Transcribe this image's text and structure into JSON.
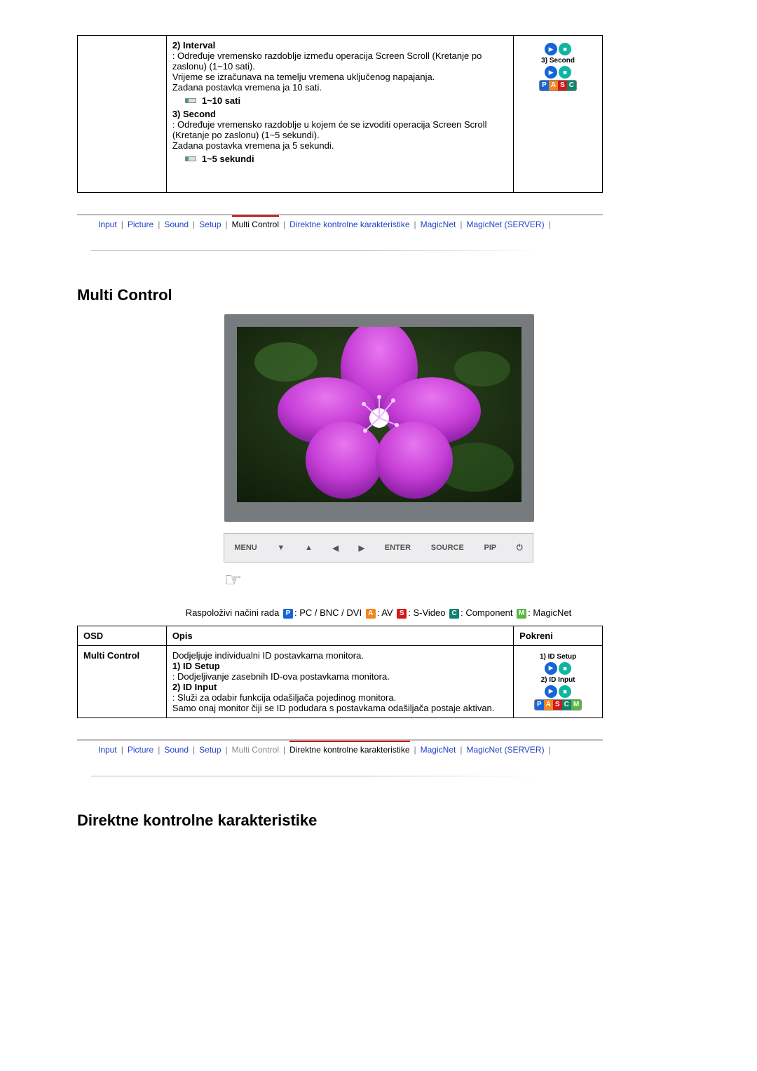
{
  "top_section": {
    "interval_heading": "2) Interval",
    "interval_text1": ": Određuje vremensko razdoblje između operacija Screen Scroll (Kretanje po zaslonu) (1~10 sati).",
    "interval_text2": "Vrijeme se izračunava na temelju vremena uključenog napajanja.",
    "interval_text3": "Zadana postavka vremena ja 10 sati.",
    "interval_bullet": "1~10 sati",
    "second_heading": "3) Second",
    "second_text1": ": Određuje vremensko razdoblje u kojem će se izvoditi operacija Screen Scroll (Kretanje po zaslonu) (1~5 sekundi).",
    "second_text2": "Zadana postavka vremena ja 5 sekundi.",
    "second_bullet": "1~5 sekundi",
    "pokreni_label": "3) Second"
  },
  "nav": {
    "items": [
      "Input",
      "Picture",
      "Sound",
      "Setup",
      "Multi Control",
      "Direktne kontrolne karakteristike",
      "MagicNet",
      "MagicNet (SERVER)"
    ],
    "active_first": 4,
    "active_second": 5
  },
  "multi_control": {
    "heading": "Multi Control",
    "osd_buttons": [
      "MENU",
      "",
      "",
      "",
      "",
      "ENTER",
      "SOURCE",
      "PIP",
      ""
    ],
    "modes_prefix": "Raspoloživi načini rada",
    "modes": [
      {
        "badge": "P",
        "color": "mb-p",
        "label": ": PC / BNC / DVI"
      },
      {
        "badge": "A",
        "color": "mb-a",
        "label": ": AV"
      },
      {
        "badge": "S",
        "color": "mb-s",
        "label": ": S-Video"
      },
      {
        "badge": "C",
        "color": "mb-c",
        "label": ": Component"
      },
      {
        "badge": "M",
        "color": "mb-m",
        "label": ": MagicNet"
      }
    ],
    "table_headers": {
      "osd": "OSD",
      "opis": "Opis",
      "pokreni": "Pokreni"
    },
    "row_label": "Multi Control",
    "opis_intro": "Dodjeljuje individualni ID postavkama monitora.",
    "id_setup_head": "1) ID Setup",
    "id_setup_text": ": Dodjeljivanje zasebnih ID-ova postavkama monitora.",
    "id_input_head": "2) ID Input",
    "id_input_text1": ": Služi za odabir funkcija odašiljača pojedinog monitora.",
    "id_input_text2": "Samo onaj monitor čiji se ID podudara s postavkama odašiljača postaje aktivan.",
    "pokreni_labels": [
      "1) ID Setup",
      "2) ID Input"
    ]
  },
  "direktne_heading": "Direktne kontrolne karakteristike"
}
